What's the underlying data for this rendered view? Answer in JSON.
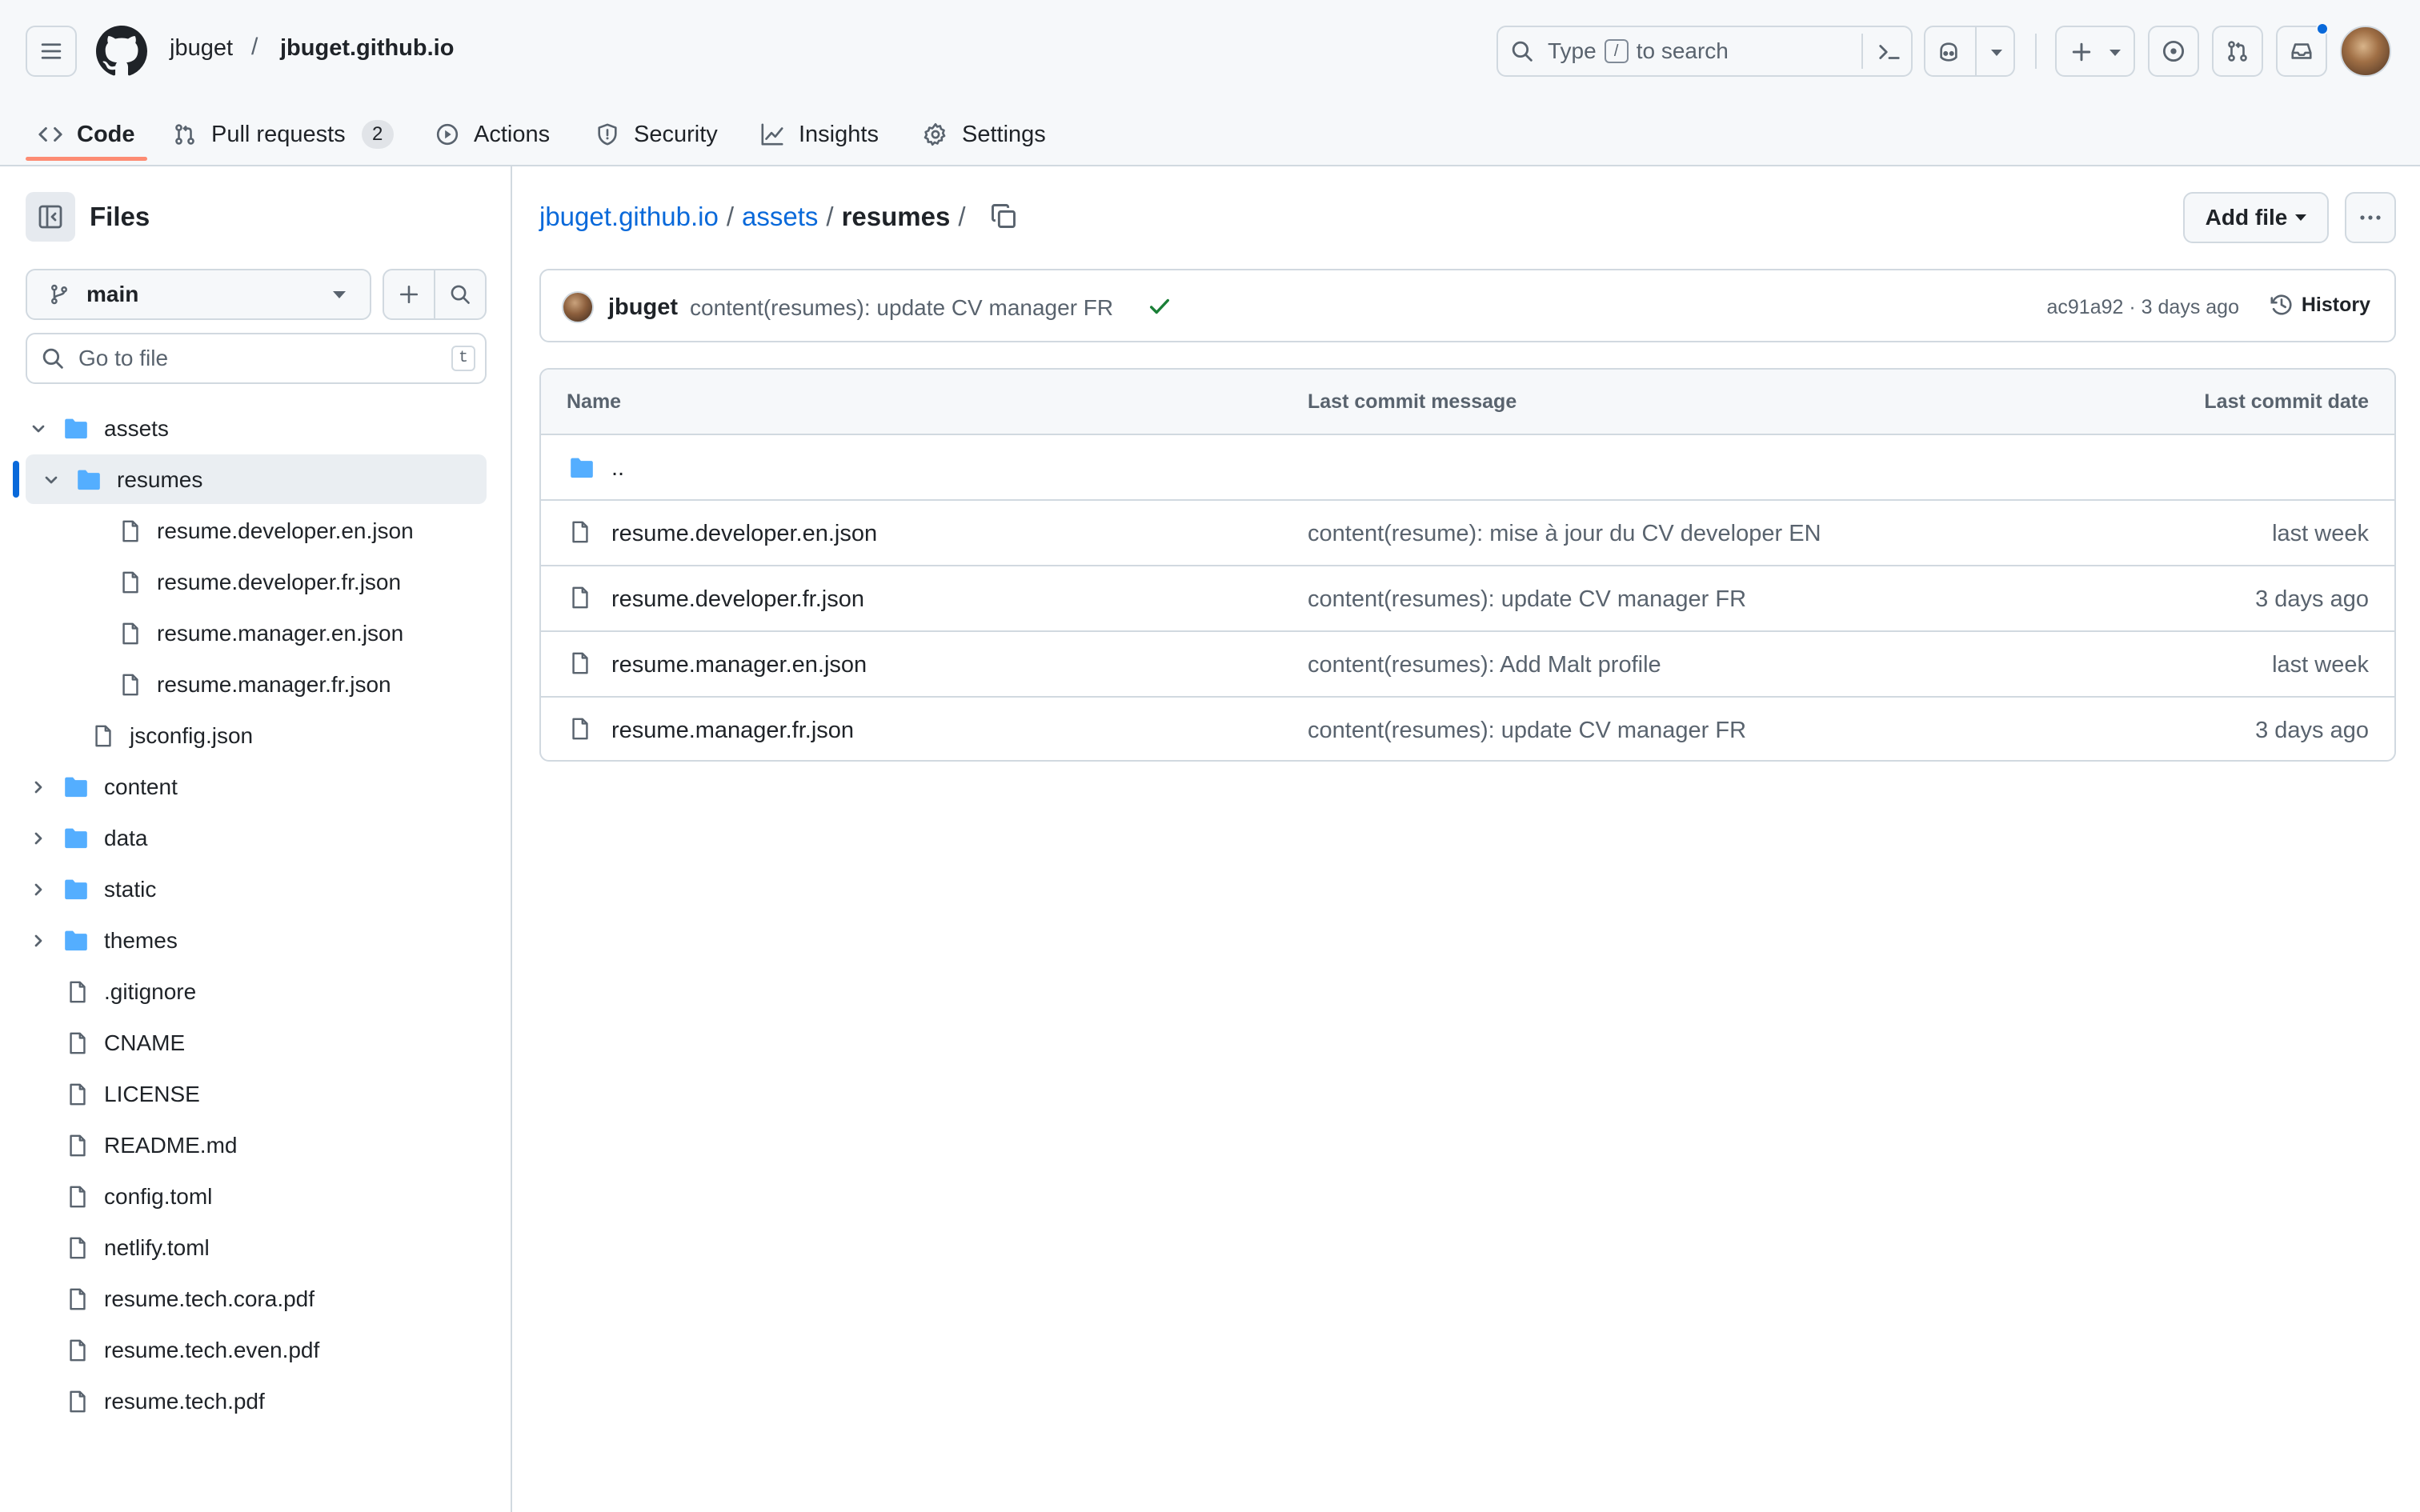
{
  "header": {
    "owner": "jbuget",
    "separator": "/",
    "repo": "jbuget.github.io",
    "search": {
      "prefix": "Type",
      "key": "/",
      "suffix": "to search"
    },
    "notification_dot_color": "#0969da"
  },
  "tabs": [
    {
      "label": "Code",
      "icon": "code-icon",
      "active": true
    },
    {
      "label": "Pull requests",
      "icon": "git-pull-request-icon",
      "count": "2"
    },
    {
      "label": "Actions",
      "icon": "play-icon"
    },
    {
      "label": "Security",
      "icon": "shield-icon"
    },
    {
      "label": "Insights",
      "icon": "graph-icon"
    },
    {
      "label": "Settings",
      "icon": "gear-icon"
    }
  ],
  "sidebar": {
    "title": "Files",
    "branch": "main",
    "goto_placeholder": "Go to file",
    "goto_shortcut": "t",
    "tree": [
      {
        "label": "assets",
        "type": "folder",
        "expanded": true,
        "depth": 0
      },
      {
        "label": "resumes",
        "type": "folder",
        "expanded": true,
        "depth": 1,
        "selected": true
      },
      {
        "label": "resume.developer.en.json",
        "type": "file",
        "depth": 2
      },
      {
        "label": "resume.developer.fr.json",
        "type": "file",
        "depth": 2
      },
      {
        "label": "resume.manager.en.json",
        "type": "file",
        "depth": 2
      },
      {
        "label": "resume.manager.fr.json",
        "type": "file",
        "depth": 2
      },
      {
        "label": "jsconfig.json",
        "type": "file",
        "depth": 1
      },
      {
        "label": "content",
        "type": "folder",
        "expanded": false,
        "depth": 0
      },
      {
        "label": "data",
        "type": "folder",
        "expanded": false,
        "depth": 0
      },
      {
        "label": "static",
        "type": "folder",
        "expanded": false,
        "depth": 0
      },
      {
        "label": "themes",
        "type": "folder",
        "expanded": false,
        "depth": 0
      },
      {
        "label": ".gitignore",
        "type": "file",
        "depth": 0
      },
      {
        "label": "CNAME",
        "type": "file",
        "depth": 0
      },
      {
        "label": "LICENSE",
        "type": "file",
        "depth": 0
      },
      {
        "label": "README.md",
        "type": "file",
        "depth": 0
      },
      {
        "label": "config.toml",
        "type": "file",
        "depth": 0
      },
      {
        "label": "netlify.toml",
        "type": "file",
        "depth": 0
      },
      {
        "label": "resume.tech.cora.pdf",
        "type": "file",
        "depth": 0
      },
      {
        "label": "resume.tech.even.pdf",
        "type": "file",
        "depth": 0
      },
      {
        "label": "resume.tech.pdf",
        "type": "file",
        "depth": 0
      }
    ]
  },
  "breadcrumb": {
    "repo": "jbuget.github.io",
    "folder": "assets",
    "current": "resumes",
    "sep": "/"
  },
  "actions": {
    "add_file": "Add file"
  },
  "commit": {
    "author": "jbuget",
    "message": "content(resumes): update CV manager FR",
    "hash": "ac91a92",
    "dot": "·",
    "date": "3 days ago",
    "history_label": "History",
    "status_color": "#1a7f37"
  },
  "table": {
    "headers": {
      "name": "Name",
      "message": "Last commit message",
      "date": "Last commit date"
    },
    "parent": "..",
    "rows": [
      {
        "name": "resume.developer.en.json",
        "message": "content(resume): mise à jour du CV developer EN",
        "date": "last week"
      },
      {
        "name": "resume.developer.fr.json",
        "message": "content(resumes): update CV manager FR",
        "date": "3 days ago"
      },
      {
        "name": "resume.manager.en.json",
        "message": "content(resumes): Add Malt profile",
        "date": "last week"
      },
      {
        "name": "resume.manager.fr.json",
        "message": "content(resumes): update CV manager FR",
        "date": "3 days ago"
      }
    ]
  },
  "colors": {
    "accent_link": "#0969da",
    "folder": "#54aeff",
    "tab_underline": "#fd8c73"
  }
}
